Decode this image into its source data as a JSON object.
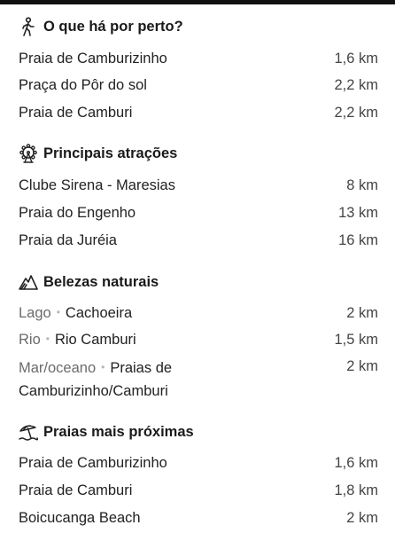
{
  "sections": [
    {
      "title": "O que há por perto?",
      "icon": "walking-person-icon",
      "rows": [
        {
          "name": "Praia de Camburizinho",
          "dist": "1,6 km"
        },
        {
          "name": "Praça do Pôr do sol",
          "dist": "2,2 km"
        },
        {
          "name": "Praia de Camburi",
          "dist": "2,2 km"
        }
      ]
    },
    {
      "title": "Principais atrações",
      "icon": "attractions-icon",
      "rows": [
        {
          "name": "Clube Sirena - Maresias",
          "dist": "8 km"
        },
        {
          "name": "Praia do Engenho",
          "dist": "13 km"
        },
        {
          "name": "Praia da Juréia",
          "dist": "16 km"
        }
      ]
    },
    {
      "title": "Belezas naturais",
      "icon": "mountain-icon",
      "rows": [
        {
          "cat": "Lago",
          "name": "Cachoeira",
          "dist": "2 km"
        },
        {
          "cat": "Rio",
          "name": "Rio Camburi",
          "dist": "1,5 km"
        },
        {
          "cat": "Mar/oceano",
          "name": "Praias de Camburizinho/Camburi",
          "dist": "2 km"
        }
      ]
    },
    {
      "title": "Praias mais próximas",
      "icon": "beach-umbrella-icon",
      "rows": [
        {
          "name": "Praia de Camburizinho",
          "dist": "1,6 km"
        },
        {
          "name": "Praia de Camburi",
          "dist": "1,8 km"
        },
        {
          "name": "Boicucanga Beach",
          "dist": "2 km"
        }
      ]
    }
  ]
}
